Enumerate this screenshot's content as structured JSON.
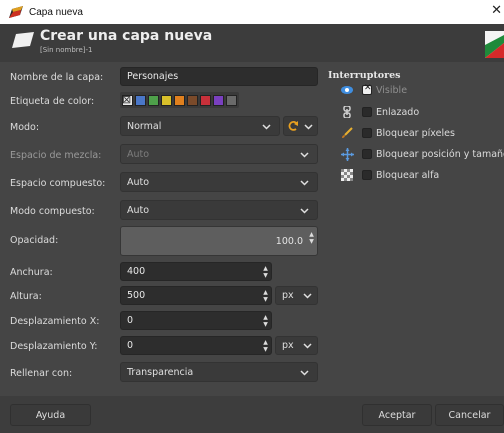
{
  "window": {
    "title": "Capa nueva",
    "close_glyph": "✕"
  },
  "header": {
    "title": "Crear una capa nueva",
    "subtitle": "[Sin nombre]-1"
  },
  "form": {
    "layer_name": {
      "label": "Nombre de la capa:",
      "value": "Personajes"
    },
    "color_tag": {
      "label": "Etiqueta de color:",
      "colors": [
        "#4a77c8",
        "#4ea04a",
        "#d8c02a",
        "#e0801e",
        "#7a4a2a",
        "#c8303a",
        "#7a40c0",
        "#6a6a6a"
      ]
    },
    "mode": {
      "label": "Modo:",
      "value": "Normal"
    },
    "blend_space": {
      "label": "Espacio de mezcla:",
      "value": "Auto"
    },
    "composite_space": {
      "label": "Espacio compuesto:",
      "value": "Auto"
    },
    "composite_mode": {
      "label": "Modo compuesto:",
      "value": "Auto"
    },
    "opacity": {
      "label": "Opacidad:",
      "value": "100.0"
    },
    "width": {
      "label": "Anchura:",
      "value": "400"
    },
    "height": {
      "label": "Altura:",
      "value": "500",
      "unit": "px"
    },
    "offset_x": {
      "label": "Desplazamiento X:",
      "value": "0"
    },
    "offset_y": {
      "label": "Desplazamiento Y:",
      "value": "0",
      "unit": "px"
    },
    "fill": {
      "label": "Rellenar con:",
      "value": "Transparencia"
    }
  },
  "switches": {
    "title": "Interruptores",
    "visible": {
      "label": "Visible",
      "icon": "eye-icon",
      "checked": true
    },
    "linked": {
      "label": "Enlazado",
      "icon": "chain-icon",
      "checked": false
    },
    "lock_pixels": {
      "label": "Bloquear píxeles",
      "icon": "brush-icon",
      "checked": false
    },
    "lock_position": {
      "label": "Bloquear posición y tamaño",
      "icon": "move-icon",
      "checked": false
    },
    "lock_alpha": {
      "label": "Bloquear alfa",
      "icon": "checkerboard-icon",
      "checked": false
    }
  },
  "buttons": {
    "help": "Ayuda",
    "ok": "Aceptar",
    "cancel": "Cancelar"
  }
}
